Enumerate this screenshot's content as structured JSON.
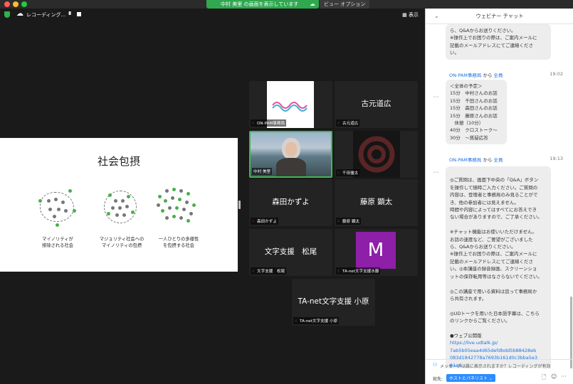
{
  "window": {
    "sharing_banner": "中村 美里 の画面を表示しています",
    "view_options": "ビュー オプション ⌄",
    "colors": {
      "close": "#fe5f57",
      "minimize": "#febc2e",
      "maximize": "#28c840"
    }
  },
  "meeting": {
    "recording_label": "レコーディング...",
    "pause_icon": "II",
    "view_label": "表示"
  },
  "slide": {
    "title": "社会包摂",
    "captions": [
      "マイノリティが\n排除される社会",
      "マジョリティ社会への\nマイノリティの包摂",
      "一人ひとりの多様性\nを包摂する社会"
    ]
  },
  "tiles": [
    {
      "name": "ON-PAM事務局",
      "big": ""
    },
    {
      "name": "古元道広",
      "big": "古元道広"
    },
    {
      "name": "中村 美里",
      "big": ""
    },
    {
      "name": "千田優太",
      "big": ""
    },
    {
      "name": "森田かずよ",
      "big": "森田かずよ"
    },
    {
      "name": "藤原 顕太",
      "big": "藤原 顕太"
    },
    {
      "name": "文字支援　松尾",
      "big": "文字支援　松尾"
    },
    {
      "name": "TA-net文字支援水藤",
      "big": "M"
    },
    {
      "name": "TA-net文字支援 小原",
      "big": "TA-net文字支援 小原"
    }
  ],
  "chat": {
    "title": "ウェビナー チャット",
    "collapse_icon": "⌄",
    "messages": [
      {
        "text": "ら、Q&Aからお送りください。\n※操作上でお困りの際は、ご案内メールに\n記載のメールアドレスにてご連絡くださ\nい。"
      },
      {
        "sender": "ON-PAM事務局",
        "from": "から",
        "to": "全員",
        "time": "19:02",
        "text": "＜全体の予定＞\n15分　中村さんのお話\n15分　千田さんのお話\n15分　森田さんのお話\n15分　藤原さんのお話\n　休憩（10分）\n40分　クロストーク〜\n30分　〜質疑応答"
      },
      {
        "sender": "ON-PAM事務局",
        "from": "から",
        "to": "全員",
        "time": "19:13",
        "text": "◎ご質問は、画面下中央の「Q&A」ボタン\nを操作して随時ご入力ください。ご質問の\n内容は、登壇者と事務局のみ見ることがで\nき、他の参加者には見えません。\n時間や内容によってはすべてにお答えでき\nない場合がありますので、ご了承ください。\n\n※チャット機能はお使いいただけません。\nお話の速度など、ご要望がございました\nら、Q&Aからお送りください。\n※操作上でお困りの際は、ご案内メールに\n記載のメールアドレスにてご連絡くださ\nい。◎本講座の録音録画、スクリーンショ\nットの保存転用等はなさらないでください。\n\n◎この講座で用いる資料は追って事務局か\nら共有されます。\n\n◎UDトークを用いた日本語字幕は、こちら\nのリンクからご覧ください。\n\n●ウェブ公開版",
        "link": "https://live.udtalk.jp/\n7ab5b05eaa4d65defdbdd5b88428eb\n083d1842778a7693b161d0c3bba5e3\n81a6"
      }
    ],
    "notice": "メッセージは誰に表示されますか？レコーディングが有効",
    "to_label": "宛先:",
    "to_value": "ホストとパネリスト ⌄",
    "file_icon": "🗋",
    "emoji_icon": "☺",
    "more_icon": "···"
  }
}
